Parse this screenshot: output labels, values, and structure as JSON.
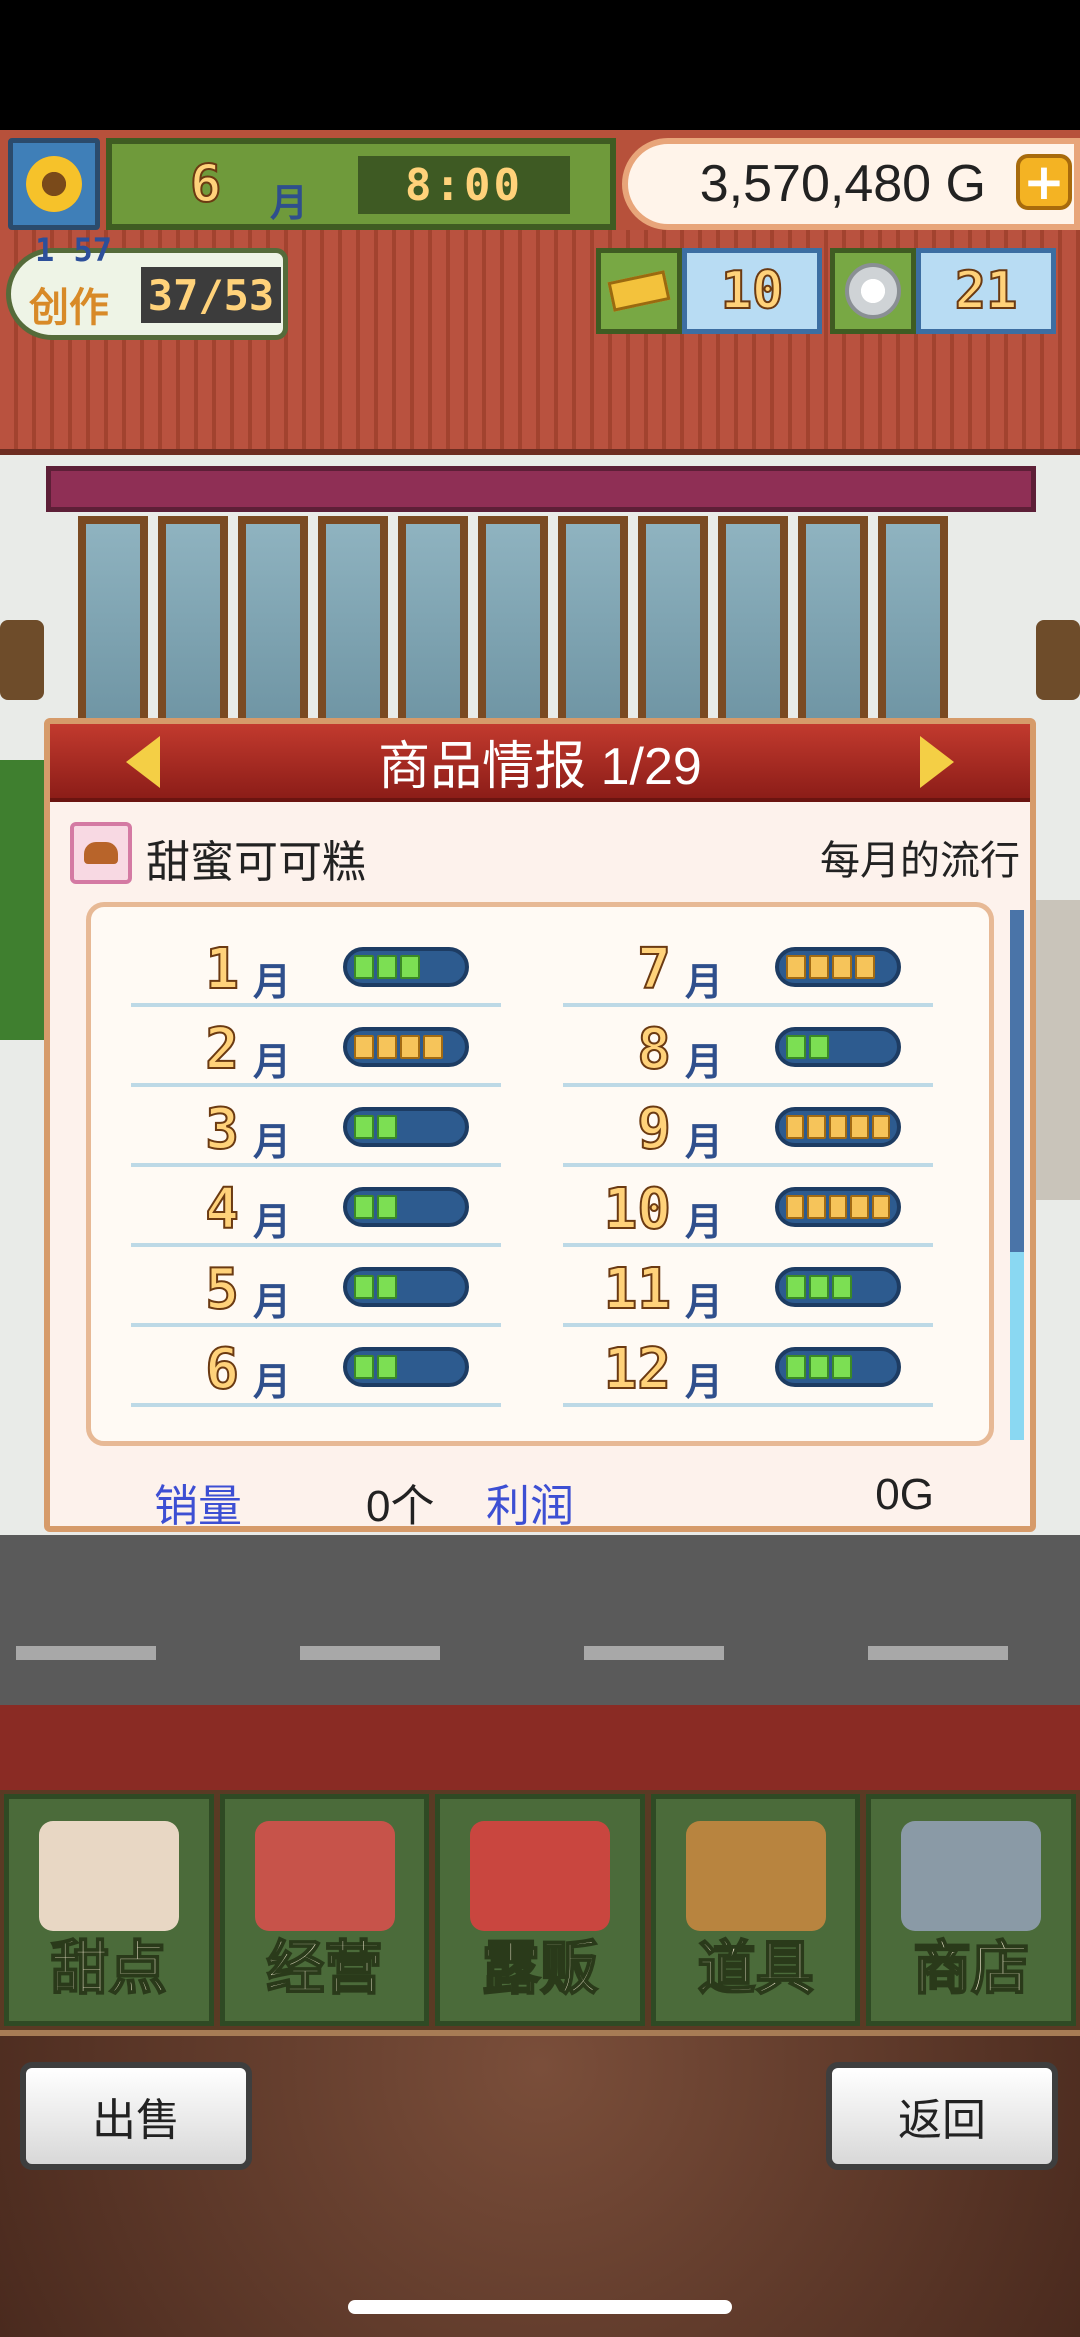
{
  "hud": {
    "month_num": "6",
    "month_unit": "月",
    "time": "8:00",
    "money": "3,570,480 G",
    "create": {
      "level": "1 57",
      "label": "创作",
      "count": "37/53"
    },
    "tickets": "10",
    "medals": "21"
  },
  "panel": {
    "title": "商品情报 1/29",
    "product_name": "甜蜜可可糕",
    "trend_label": "每月的流行",
    "month_unit": "月",
    "months": [
      {
        "num": "1",
        "level": 3,
        "color": "green"
      },
      {
        "num": "2",
        "level": 4,
        "color": "gold"
      },
      {
        "num": "3",
        "level": 2,
        "color": "green"
      },
      {
        "num": "4",
        "level": 2,
        "color": "green"
      },
      {
        "num": "5",
        "level": 2,
        "color": "green"
      },
      {
        "num": "6",
        "level": 2,
        "color": "green"
      },
      {
        "num": "7",
        "level": 4,
        "color": "gold"
      },
      {
        "num": "8",
        "level": 2,
        "color": "green"
      },
      {
        "num": "9",
        "level": 5,
        "color": "gold"
      },
      {
        "num": "10",
        "level": 5,
        "color": "gold"
      },
      {
        "num": "11",
        "level": 3,
        "color": "green"
      },
      {
        "num": "12",
        "level": 3,
        "color": "green"
      }
    ],
    "sales_label": "销量",
    "sales_value": "0个",
    "profit_label": "利润",
    "profit_value": "0G"
  },
  "menu": {
    "items": [
      {
        "label": "甜点",
        "color": "#e8d7c4"
      },
      {
        "label": "经营",
        "color": "#c7534a"
      },
      {
        "label": "露贩",
        "color": "#c9463f"
      },
      {
        "label": "道具",
        "color": "#b8843f"
      },
      {
        "label": "商店",
        "color": "#8a9aa6"
      }
    ]
  },
  "buttons": {
    "sell": "出售",
    "back": "返回"
  }
}
